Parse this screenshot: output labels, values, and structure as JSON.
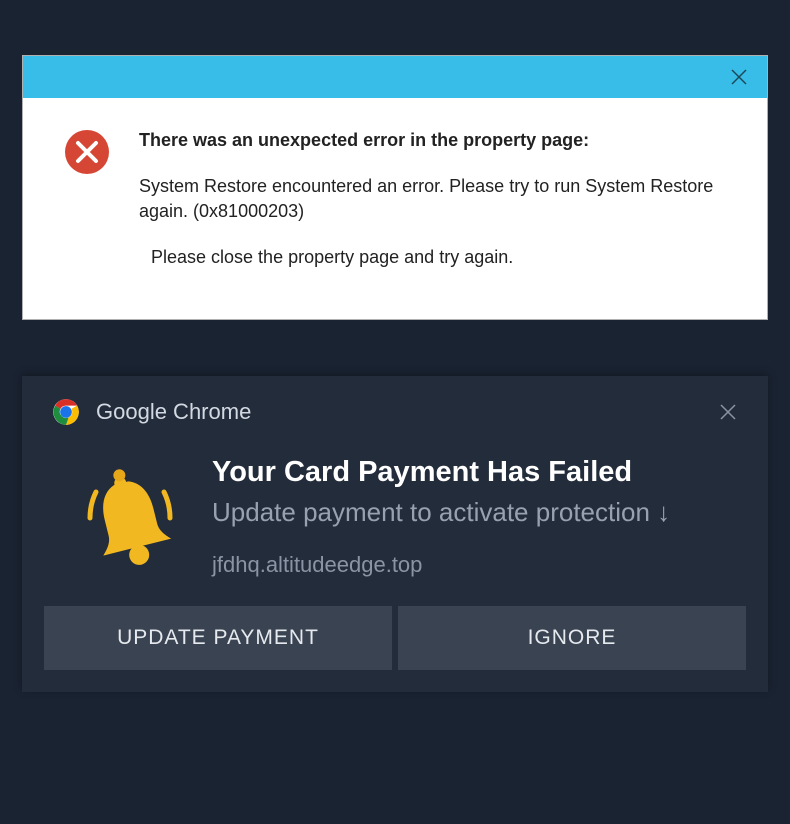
{
  "error_dialog": {
    "heading": "There was an unexpected error in the property page:",
    "line1": "System Restore encountered an error. Please try to run System Restore again. (0x81000203)",
    "line2": "Please close the property page and try again."
  },
  "notification": {
    "app_name": "Google Chrome",
    "title": "Your Card Payment Has Failed",
    "subtitle": "Update payment to activate protection ↓",
    "domain": "jfdhq.altitudeedge.top",
    "buttons": {
      "primary": "UPDATE PAYMENT",
      "secondary": "IGNORE"
    }
  }
}
